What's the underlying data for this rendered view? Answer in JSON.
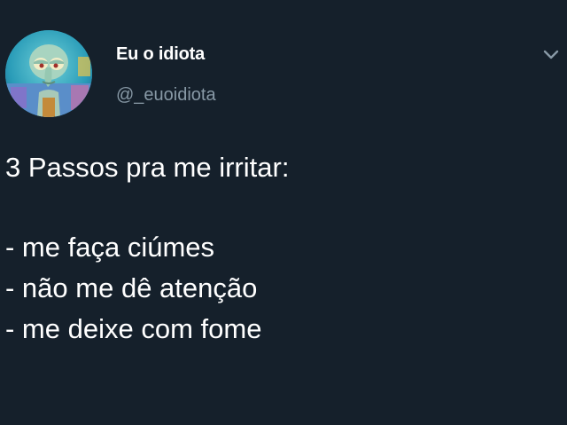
{
  "colors": {
    "background": "#15202b",
    "primary_text": "#ffffff",
    "secondary_text": "#8899a6"
  },
  "author": {
    "display_name": "Eu o idiota",
    "handle": "@_euoidiota",
    "avatar_icon": "squidward-avatar"
  },
  "menu": {
    "icon": "chevron-down-icon"
  },
  "tweet": {
    "lines": [
      "3 Passos pra me irritar:",
      "",
      "- me faça ciúmes",
      "- não me dê atenção",
      "- me deixe com fome"
    ]
  }
}
